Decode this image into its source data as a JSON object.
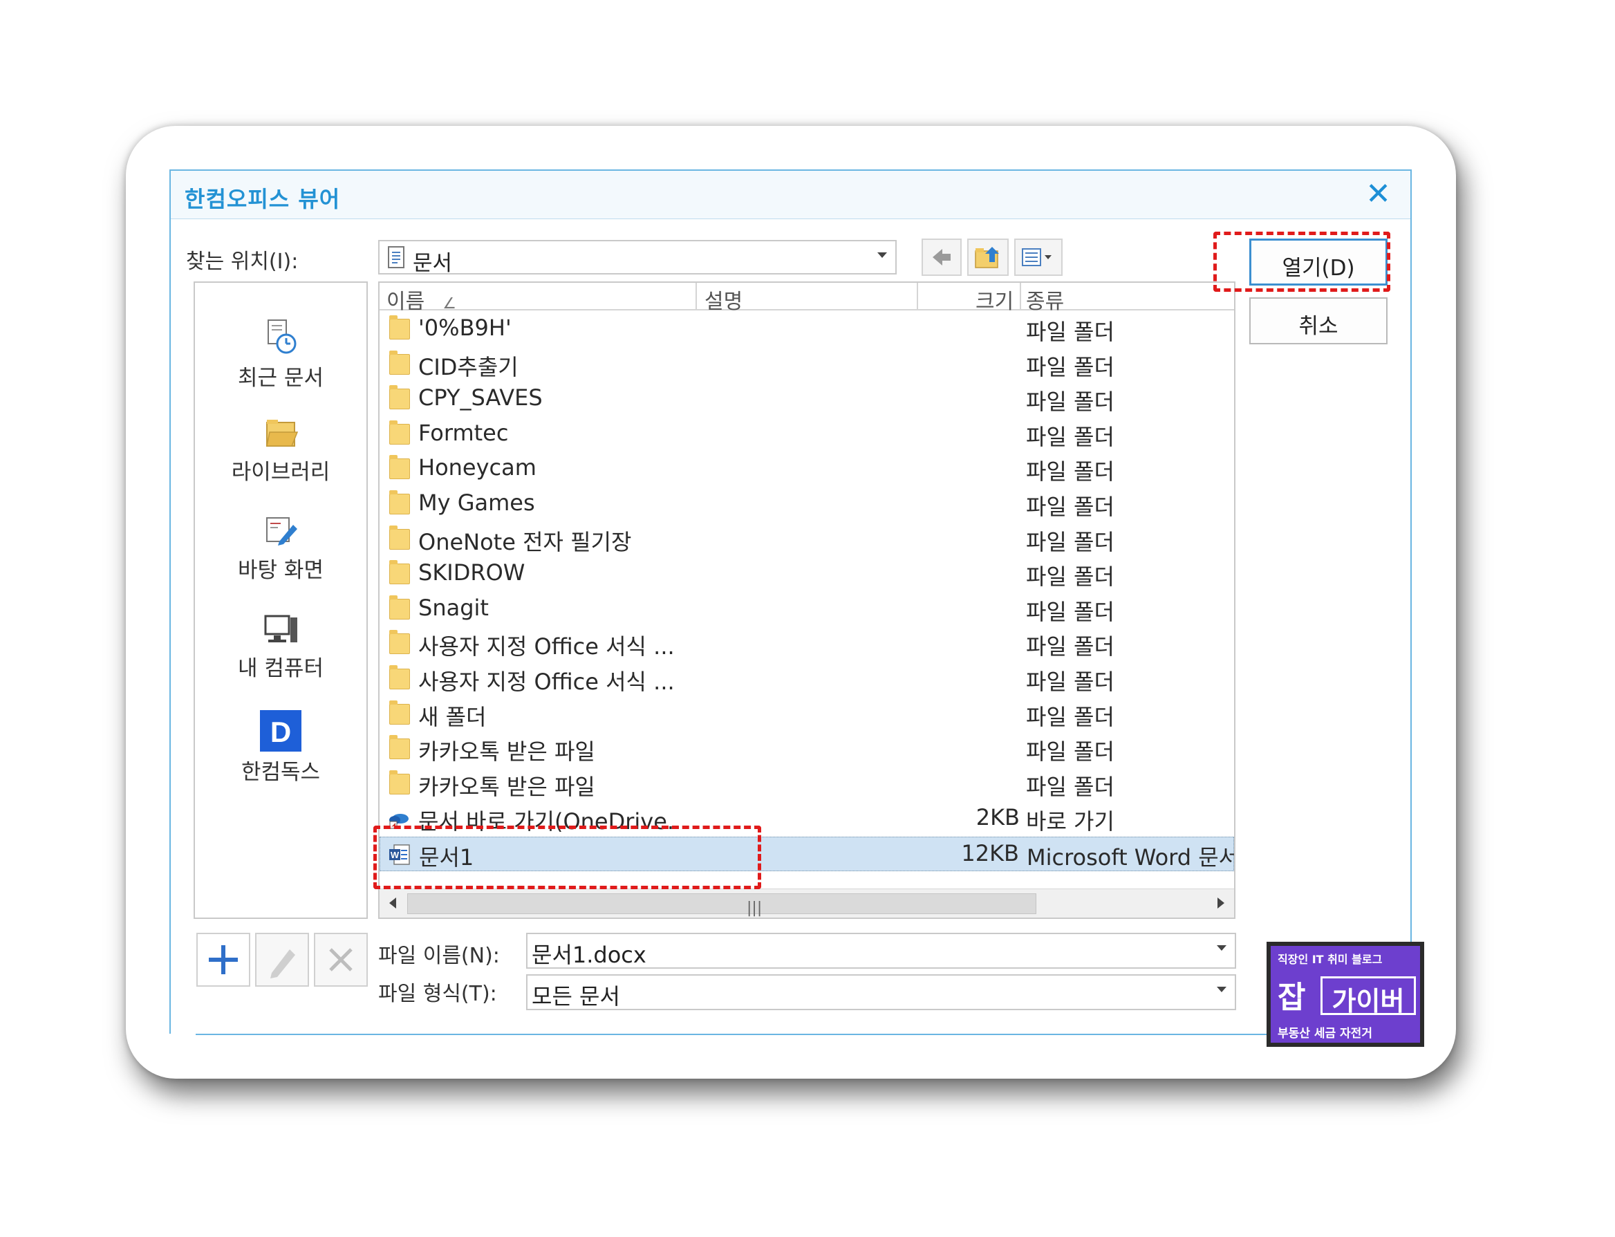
{
  "dialog": {
    "title": "한컴오피스 뷰어",
    "look_in_label": "찾는 위치(I):",
    "look_in_value": "문서"
  },
  "places": [
    {
      "label": "최근 문서",
      "icon": "recent-docs-icon"
    },
    {
      "label": "라이브러리",
      "icon": "library-icon"
    },
    {
      "label": "바탕 화면",
      "icon": "desktop-icon"
    },
    {
      "label": "내 컴퓨터",
      "icon": "computer-icon"
    },
    {
      "label": "한컴독스",
      "icon": "hancomdocs-icon"
    }
  ],
  "columns": {
    "name": "이름",
    "desc": "설명",
    "size": "크기",
    "type": "종류"
  },
  "files": [
    {
      "name": "'0%B9H'",
      "size": "",
      "type": "파일 폴더",
      "icon": "folder-icon"
    },
    {
      "name": "CID추출기",
      "size": "",
      "type": "파일 폴더",
      "icon": "folder-icon"
    },
    {
      "name": "CPY_SAVES",
      "size": "",
      "type": "파일 폴더",
      "icon": "folder-icon"
    },
    {
      "name": "Formtec",
      "size": "",
      "type": "파일 폴더",
      "icon": "folder-icon"
    },
    {
      "name": "Honeycam",
      "size": "",
      "type": "파일 폴더",
      "icon": "folder-icon"
    },
    {
      "name": "My Games",
      "size": "",
      "type": "파일 폴더",
      "icon": "folder-icon"
    },
    {
      "name": "OneNote 전자 필기장",
      "size": "",
      "type": "파일 폴더",
      "icon": "folder-icon"
    },
    {
      "name": "SKIDROW",
      "size": "",
      "type": "파일 폴더",
      "icon": "folder-icon"
    },
    {
      "name": "Snagit",
      "size": "",
      "type": "파일 폴더",
      "icon": "folder-icon"
    },
    {
      "name": "사용자 지정 Office 서식 ...",
      "size": "",
      "type": "파일 폴더",
      "icon": "folder-icon"
    },
    {
      "name": "사용자 지정 Office 서식 ...",
      "size": "",
      "type": "파일 폴더",
      "icon": "folder-icon"
    },
    {
      "name": "새 폴더",
      "size": "",
      "type": "파일 폴더",
      "icon": "folder-icon"
    },
    {
      "name": "카카오톡 받은 파일",
      "size": "",
      "type": "파일 폴더",
      "icon": "folder-icon"
    },
    {
      "name": "카카오톡 받은 파일",
      "size": "",
      "type": "파일 폴더",
      "icon": "folder-icon"
    },
    {
      "name": "문서 바로 가기(OneDrive...",
      "size": "2KB",
      "type": "바로 가기",
      "icon": "onedrive-shortcut-icon"
    },
    {
      "name": "문서1",
      "size": "12KB",
      "type": "Microsoft Word 문서",
      "icon": "word-doc-icon",
      "selected": true
    }
  ],
  "buttons": {
    "open": "열기(D)",
    "cancel": "취소"
  },
  "filename": {
    "label": "파일 이름(N):",
    "value": "문서1.docx"
  },
  "filetype": {
    "label": "파일 형식(T):",
    "value": "모든 문서"
  },
  "badge": {
    "top": "직장인 IT 취미 블로그",
    "big1": "잡",
    "big2": "가이버",
    "bottom": "부동산 세금 자전거"
  },
  "colors": {
    "accent": "#2392d4",
    "selection": "#cfe2f3",
    "highlight": "#e01b1b",
    "badge": "#6d3fce"
  }
}
